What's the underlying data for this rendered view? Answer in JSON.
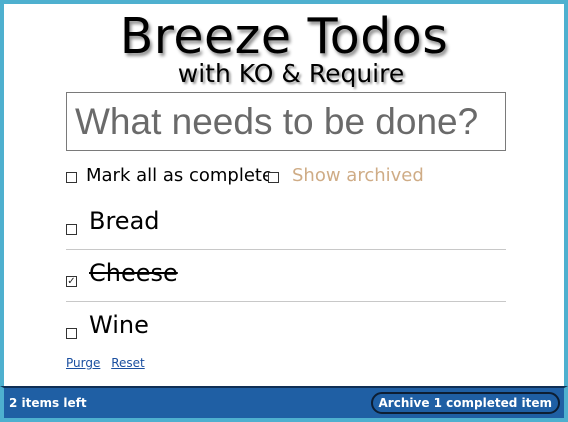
{
  "header": {
    "title": "Breeze Todos",
    "subtitle": "with KO & Require"
  },
  "new_todo": {
    "placeholder": "What needs to be done?",
    "value": ""
  },
  "options": {
    "mark_all_label": "Mark all as complete",
    "mark_all_checked": false,
    "show_archived_label": "Show archived",
    "show_archived_checked": false
  },
  "todos": [
    {
      "text": "Bread",
      "done": false
    },
    {
      "text": "Cheese",
      "done": true
    },
    {
      "text": "Wine",
      "done": false
    }
  ],
  "links": {
    "purge": "Purge",
    "reset": "Reset"
  },
  "footer": {
    "items_left": "2 items left",
    "archive_button": "Archive 1 completed item"
  },
  "colors": {
    "frame_border": "#4eb0cf",
    "footer_bg": "#1f5fa4",
    "show_archived_text": "#cfac86",
    "link": "#1a4fa0"
  }
}
